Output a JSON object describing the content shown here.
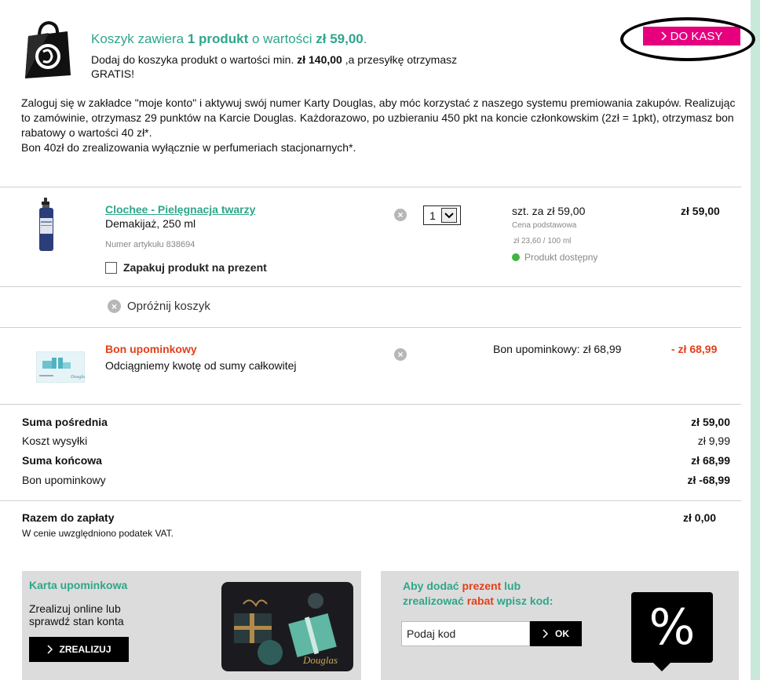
{
  "header": {
    "title_pre": "Koszyk zawiera ",
    "title_count": "1 produkt",
    "title_mid": " o wartości ",
    "title_value": "zł 59,00",
    "title_end": ".",
    "sub_pre": "Dodaj do koszyka produkt o wartości min. ",
    "sub_amount": "zł 140,00",
    "sub_post": " ,a przesyłkę otrzymasz GRATIS!",
    "checkout_label": "DO KASY"
  },
  "info_text": {
    "line1": "Zaloguj się w zakładce \"moje konto\" i aktywuj swój numer Karty Douglas, aby móc korzystać z naszego systemu premiowania zakupów. Realizując to zamówinie, otrzymasz 29 punktów na Karcie Douglas. Każdorazowo, po uzbieraniu 450 pkt na koncie członkowskim (2zł = 1pkt), otrzymasz bon rabatowy o wartości 40 zł*.",
    "line2": "Bon 40zł do zrealizowania wyłącznie w perfumeriach stacjonarnych*."
  },
  "product": {
    "name": "Clochee - Pielęgnacja twarzy",
    "description": "Demakijaż, 250 ml",
    "article_number": "Numer artykułu 838694",
    "gift_wrap_label": "Zapakuj produkt na prezent",
    "quantity": "1",
    "unit_price": "szt. za zł 59,00",
    "price_type": "Cena podstawowa",
    "price_per": "zł 23,60 / 100 ml",
    "availability": "Produkt dostępny",
    "total": "zł 59,00"
  },
  "empty_cart_label": "Opróżnij koszyk",
  "voucher": {
    "title": "Bon upominkowy",
    "description": "Odciągniemy kwotę od sumy całkowitej",
    "label": "Bon upominkowy: zł 68,99",
    "total": "- zł 68,99"
  },
  "summary": {
    "subtotal_label": "Suma pośrednia",
    "subtotal_value": "zł 59,00",
    "shipping_label": "Koszt wysyłki",
    "shipping_value": "zł 9,99",
    "final_label": "Suma końcowa",
    "final_value": "zł 68,99",
    "voucher_label": "Bon upominkowy",
    "voucher_value": "zł -68,99",
    "to_pay_label": "Razem do zapłaty",
    "to_pay_value": "zł 0,00",
    "vat_note": "W cenie uwzględniono podatek VAT."
  },
  "gift_card_box": {
    "title": "Karta upominkowa",
    "subtitle": "Zrealizuj online lub sprawdź stan konta",
    "button_label": "ZREALIZUJ",
    "card_brand": "Douglas"
  },
  "code_box": {
    "title_pre": "Aby dodać ",
    "title_red1": "prezent",
    "title_mid": " lub ",
    "title_line2_pre": "zrealizować ",
    "title_red2": "rabat",
    "title_end": " wpisz kod:",
    "input_placeholder": "Podaj kod",
    "ok_label": "OK",
    "percent_symbol": "%"
  },
  "colors": {
    "brand_green": "#2ea68a",
    "checkout_pink": "#e6007e",
    "discount_red": "#e2401b",
    "available_green": "#3fb53f"
  }
}
